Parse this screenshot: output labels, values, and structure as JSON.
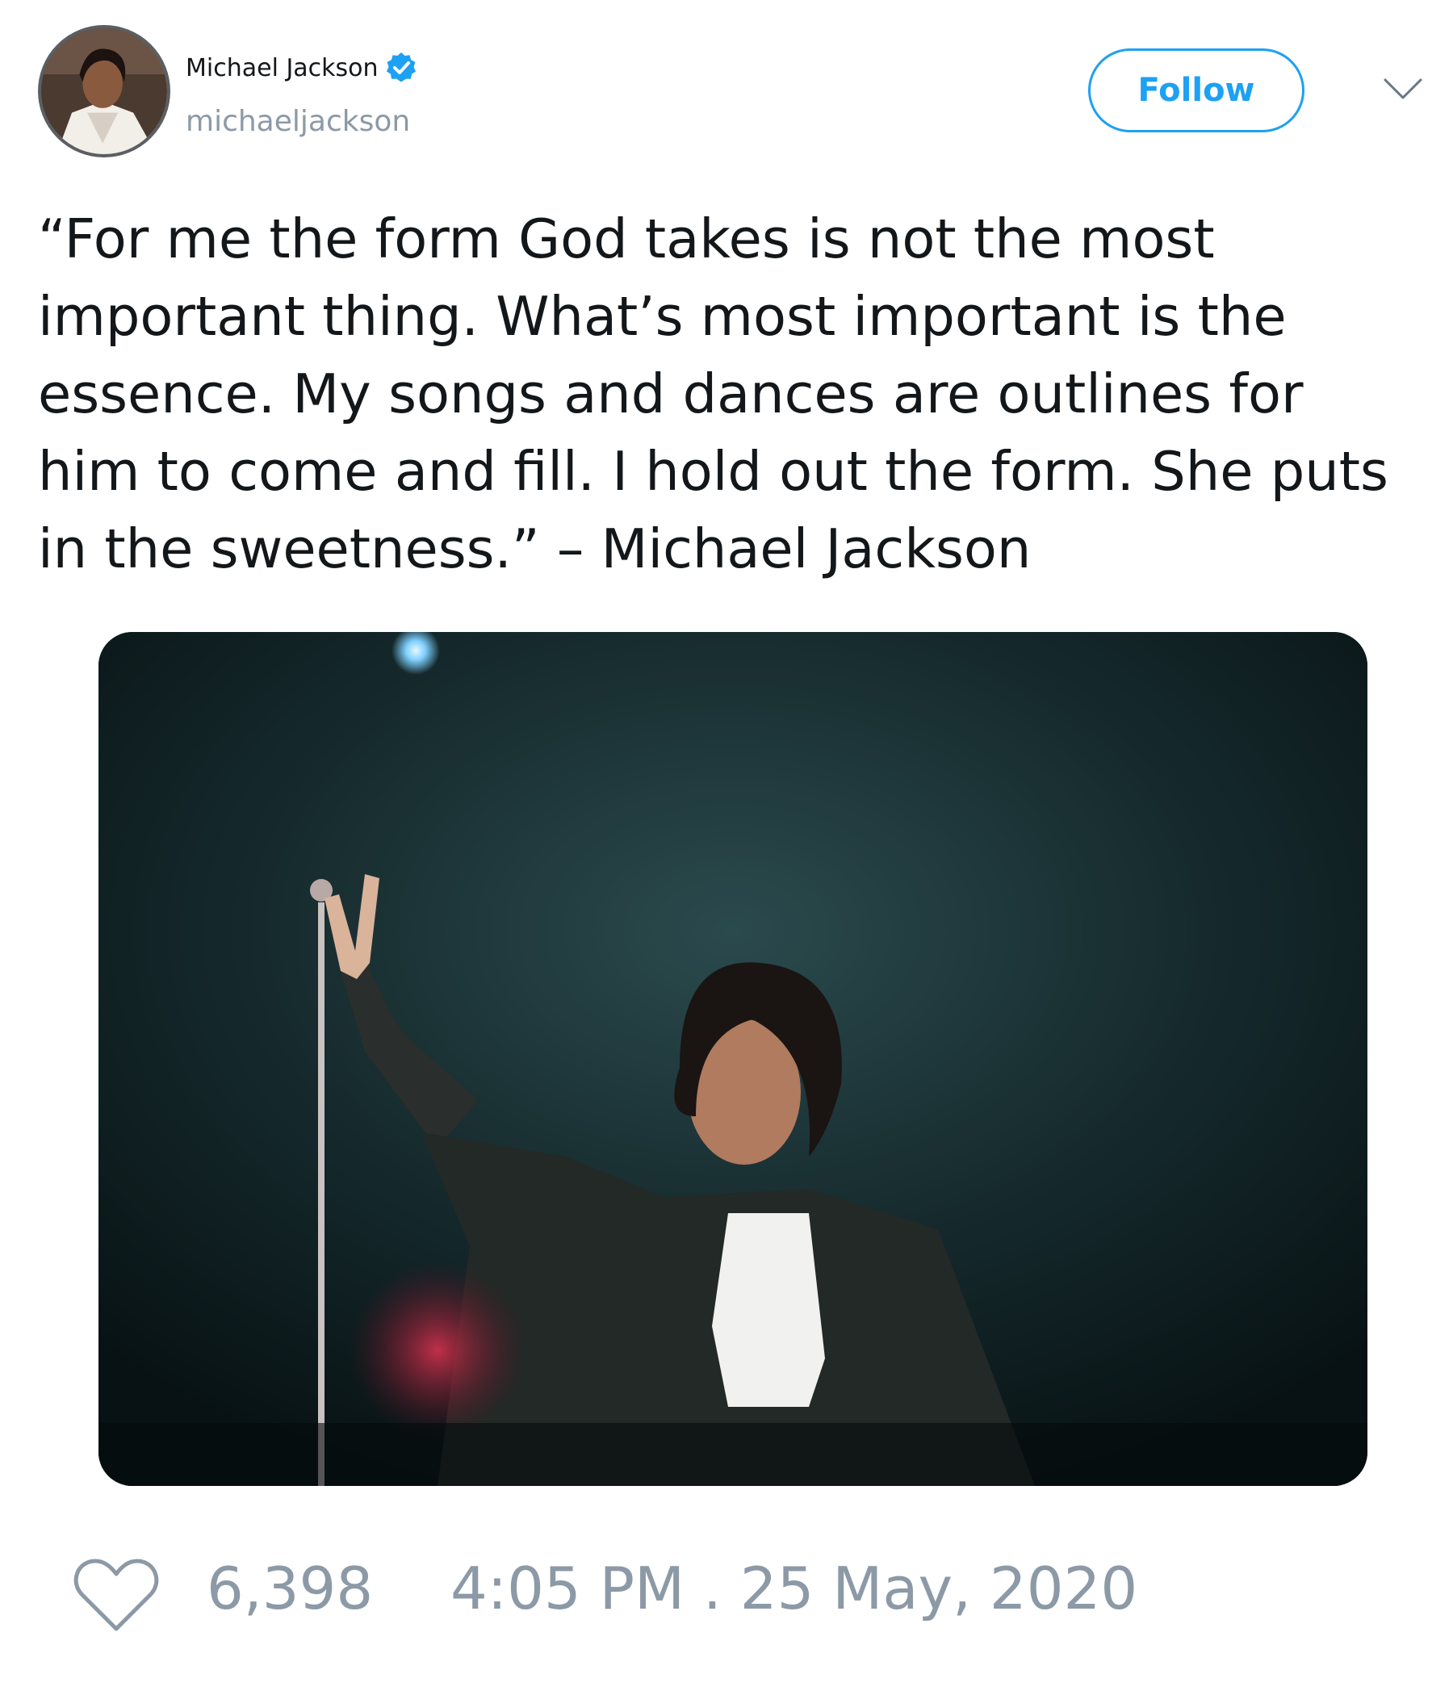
{
  "user": {
    "display_name": "Michael Jackson",
    "handle": "michaeljackson",
    "verified": true,
    "avatar_icon": "profile-photo"
  },
  "actions": {
    "follow_label": "Follow",
    "menu_icon": "chevron-down-icon"
  },
  "tweet": {
    "text": "“For me the form God takes is not the most\nimportant thing. What’s most important is the\nessence. My songs and dances are outlines for\nhim to come and fill. I hold out the form. She puts\nin the sweetness.” – Michael Jackson",
    "media_icon": "concert-photo"
  },
  "footer": {
    "like_icon": "heart-icon",
    "like_count": "6,398",
    "timestamp": "4:05 PM . 25 May, 2020"
  },
  "colors": {
    "accent": "#1da1f2",
    "secondary_text": "#8c99a6",
    "primary_text": "#14171a"
  }
}
